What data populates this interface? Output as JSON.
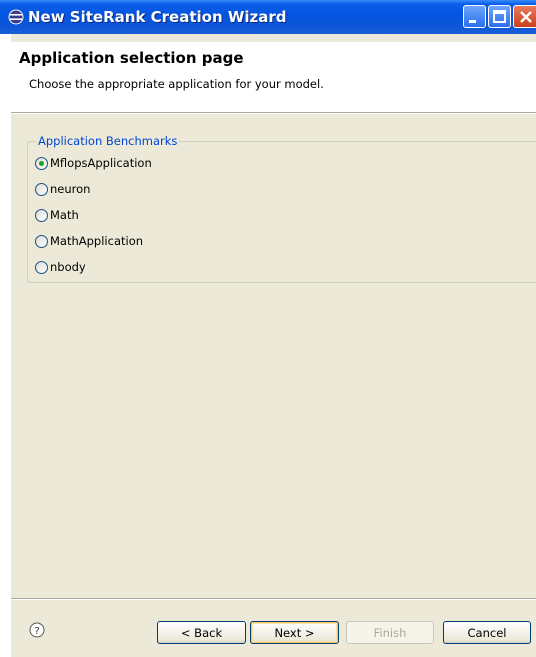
{
  "window": {
    "title": "New SiteRank Creation Wizard",
    "icon": "eclipse-wizard-icon"
  },
  "header": {
    "page_title": "Application selection page",
    "description": "Choose the appropriate application for your model."
  },
  "group": {
    "legend": "Application Benchmarks",
    "options": [
      {
        "label": "MflopsApplication",
        "selected": true
      },
      {
        "label": "neuron",
        "selected": false
      },
      {
        "label": "Math",
        "selected": false
      },
      {
        "label": "MathApplication",
        "selected": false
      },
      {
        "label": "nbody",
        "selected": false
      }
    ]
  },
  "buttons": {
    "back": "< Back",
    "next": "Next >",
    "finish": "Finish",
    "cancel": "Cancel",
    "finish_enabled": false
  },
  "colors": {
    "titlebar": "#0554e0",
    "legend": "#0046d5",
    "dialog_bg": "#ece9d8",
    "radio_selected": "#21a121"
  }
}
